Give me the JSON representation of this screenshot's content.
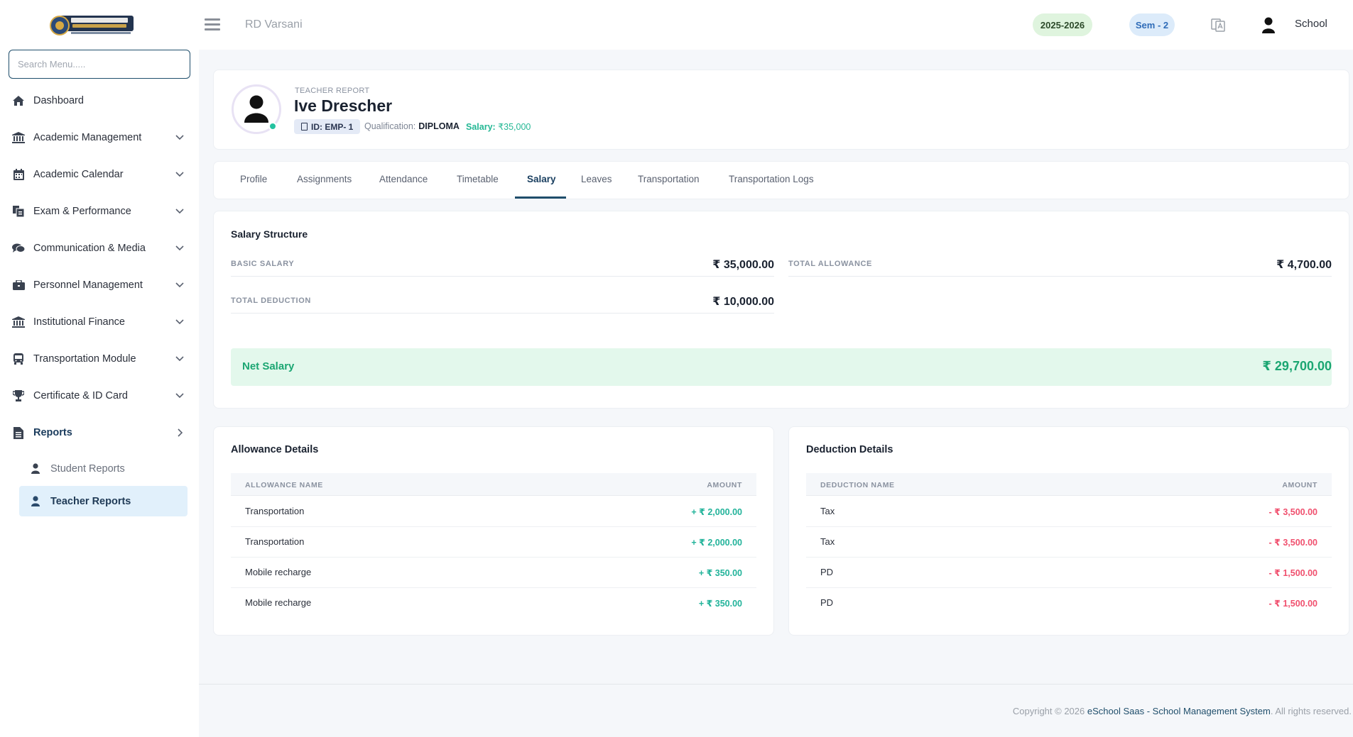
{
  "logo": {
    "text_line1": "TONY STARK",
    "text_line2": "ACADEMY OF SCHOOL"
  },
  "search": {
    "placeholder": "Search Menu....."
  },
  "sidebar": {
    "items": [
      {
        "label": "Dashboard",
        "icon": "home-icon"
      },
      {
        "label": "Academic Management",
        "icon": "institution-icon"
      },
      {
        "label": "Academic Calendar",
        "icon": "calendar-icon"
      },
      {
        "label": "Exam & Performance",
        "icon": "exam-icon"
      },
      {
        "label": "Communication & Media",
        "icon": "comments-icon"
      },
      {
        "label": "Personnel Management",
        "icon": "briefcase-icon"
      },
      {
        "label": "Institutional Finance",
        "icon": "bank-icon"
      },
      {
        "label": "Transportation Module",
        "icon": "bus-icon"
      },
      {
        "label": "Certificate & ID Card",
        "icon": "trophy-icon"
      },
      {
        "label": "Reports",
        "icon": "report-icon"
      }
    ],
    "sub_items": [
      {
        "label": "Student Reports",
        "icon": "user-icon"
      },
      {
        "label": "Teacher Reports",
        "icon": "user-icon"
      }
    ]
  },
  "header": {
    "org_name": "RD Varsani",
    "session": "2025-2026",
    "semester": "Sem - 2",
    "user_name": "School"
  },
  "profile": {
    "eyebrow": "TEACHER REPORT",
    "name": "Ive Drescher",
    "id": "ID: EMP- 1",
    "qualification_label": "Qualification:",
    "qualification": "DIPLOMA",
    "salary_label": "Salary:",
    "salary": "₹35,000"
  },
  "tabs": [
    "Profile",
    "Assignments",
    "Attendance",
    "Timetable",
    "Salary",
    "Leaves",
    "Transportation",
    "Transportation Logs"
  ],
  "active_tab": "Salary",
  "salary_structure": {
    "title": "Salary Structure",
    "basic_label": "BASIC SALARY",
    "basic_value": "₹ 35,000.00",
    "allowance_label": "TOTAL ALLOWANCE",
    "allowance_value": "₹ 4,700.00",
    "deduction_label": "TOTAL DEDUCTION",
    "deduction_value": "₹ 10,000.00",
    "net_label": "Net Salary",
    "net_value": "₹ 29,700.00"
  },
  "allowance": {
    "title": "Allowance Details",
    "col_name": "ALLOWANCE NAME",
    "col_amount": "AMOUNT",
    "rows": [
      {
        "name": "Transportation",
        "amount": "+ ₹ 2,000.00"
      },
      {
        "name": "Transportation",
        "amount": "+ ₹ 2,000.00"
      },
      {
        "name": "Mobile recharge",
        "amount": "+ ₹ 350.00"
      },
      {
        "name": "Mobile recharge",
        "amount": "+ ₹ 350.00"
      }
    ]
  },
  "deduction": {
    "title": "Deduction Details",
    "col_name": "DEDUCTION NAME",
    "col_amount": "AMOUNT",
    "rows": [
      {
        "name": "Tax",
        "amount": "- ₹ 3,500.00"
      },
      {
        "name": "Tax",
        "amount": "- ₹ 3,500.00"
      },
      {
        "name": "PD",
        "amount": "- ₹ 1,500.00"
      },
      {
        "name": "PD",
        "amount": "- ₹ 1,500.00"
      }
    ]
  },
  "footer": {
    "prefix": "Copyright © 2026",
    "link": "eSchool Saas - School Management System",
    "suffix": ". All rights reserved."
  },
  "colors": {
    "primary": "#1f4e6b",
    "success": "#1ba672",
    "danger": "#f0506e",
    "teal": "#22b39a"
  }
}
